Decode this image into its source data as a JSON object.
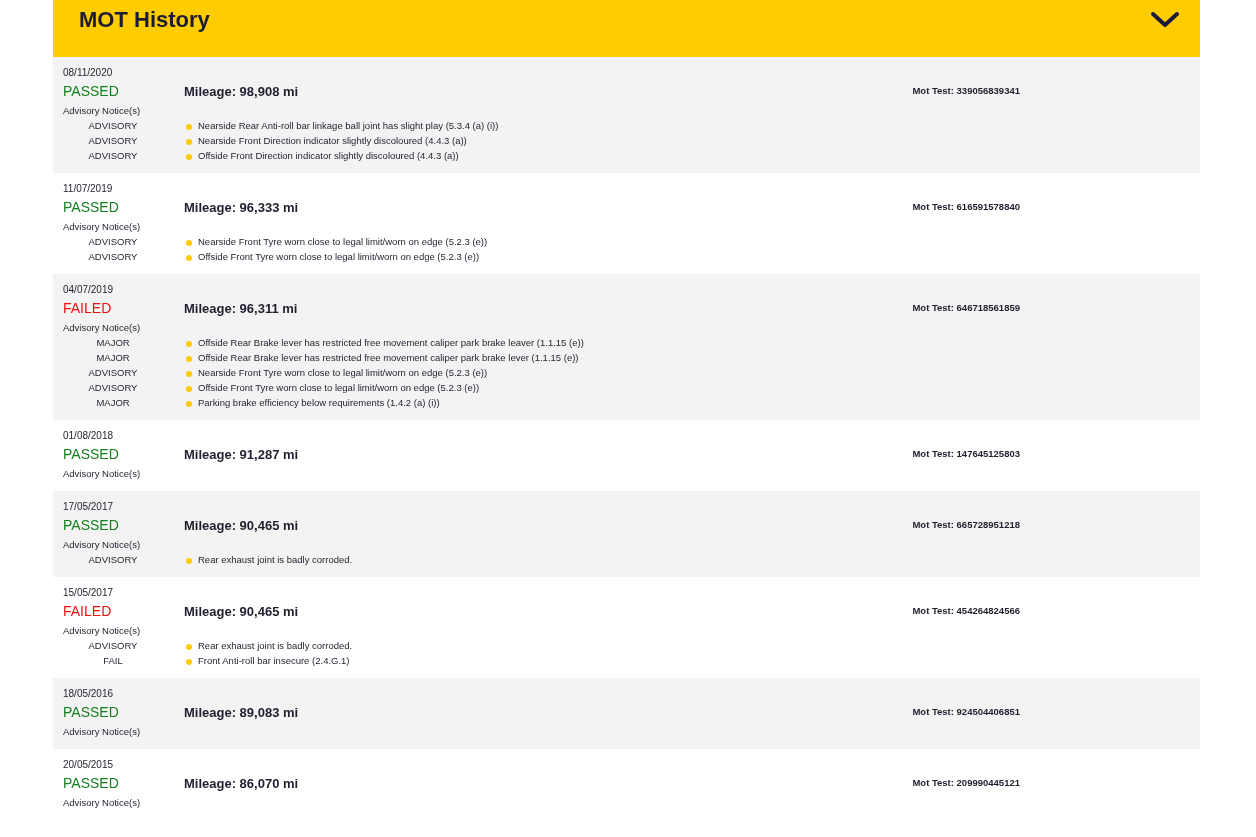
{
  "panel": {
    "title": "MOT History",
    "expanded": true
  },
  "tests": [
    {
      "date": "08/11/2020",
      "result": "PASSED",
      "kind": "passed",
      "mileage": "Mileage: 98,908 mi",
      "mot_test": "Mot Test: 339056839341",
      "notices_label": "Advisory Notice(s)",
      "items": [
        {
          "type": "ADVISORY",
          "text": "Nearside Rear Anti-roll bar linkage ball joint has slight play (5.3.4 (a) (i))"
        },
        {
          "type": "ADVISORY",
          "text": "Nearside Front Direction indicator slightly discoloured (4.4.3 (a))"
        },
        {
          "type": "ADVISORY",
          "text": "Offside Front Direction indicator slightly discoloured (4.4.3 (a))"
        }
      ]
    },
    {
      "date": "11/07/2019",
      "result": "PASSED",
      "kind": "passed",
      "mileage": "Mileage: 96,333 mi",
      "mot_test": "Mot Test: 616591578840",
      "notices_label": "Advisory Notice(s)",
      "items": [
        {
          "type": "ADVISORY",
          "text": "Nearside Front Tyre worn close to legal limit/worn on edge (5.2.3 (e))"
        },
        {
          "type": "ADVISORY",
          "text": "Offside Front Tyre worn close to legal limit/worn on edge (5.2.3 (e))"
        }
      ]
    },
    {
      "date": "04/07/2019",
      "result": "FAILED",
      "kind": "failed",
      "mileage": "Mileage: 96,311 mi",
      "mot_test": "Mot Test: 646718561859",
      "notices_label": "Advisory Notice(s)",
      "items": [
        {
          "type": "MAJOR",
          "text": "Offside Rear Brake lever has restricted free movement caliper park brake leaver (1.1.15 (e))"
        },
        {
          "type": "MAJOR",
          "text": "Offside Rear Brake lever has restricted free movement caliper park brake lever (1.1.15 (e))"
        },
        {
          "type": "ADVISORY",
          "text": "Nearside Front Tyre worn close to legal limit/worn on edge (5.2.3 (e))"
        },
        {
          "type": "ADVISORY",
          "text": "Offside Front Tyre worn close to legal limit/worn on edge (5.2.3 (e))"
        },
        {
          "type": "MAJOR",
          "text": "Parking brake efficiency below requirements (1.4.2 (a) (i))"
        }
      ]
    },
    {
      "date": "01/08/2018",
      "result": "PASSED",
      "kind": "passed",
      "mileage": "Mileage: 91,287 mi",
      "mot_test": "Mot Test: 147645125803",
      "notices_label": "Advisory Notice(s)"
    },
    {
      "date": "17/05/2017",
      "result": "PASSED",
      "kind": "passed",
      "mileage": "Mileage: 90,465 mi",
      "mot_test": "Mot Test: 665728951218",
      "notices_label": "Advisory Notice(s)",
      "items": [
        {
          "type": "ADVISORY",
          "text": "Rear exhaust joint is badly corroded."
        }
      ]
    },
    {
      "date": "15/05/2017",
      "result": "FAILED",
      "kind": "failed",
      "mileage": "Mileage: 90,465 mi",
      "mot_test": "Mot Test: 454264824566",
      "notices_label": "Advisory Notice(s)",
      "items": [
        {
          "type": "ADVISORY",
          "text": "Rear exhaust joint is badly corroded."
        },
        {
          "type": "FAIL",
          "text": "Front Anti-roll bar insecure (2.4.G.1)"
        }
      ]
    },
    {
      "date": "18/05/2016",
      "result": "PASSED",
      "kind": "passed",
      "mileage": "Mileage: 89,083 mi",
      "mot_test": "Mot Test: 924504406851",
      "notices_label": "Advisory Notice(s)"
    },
    {
      "date": "20/05/2015",
      "result": "PASSED",
      "kind": "passed",
      "mileage": "Mileage: 86,070 mi",
      "mot_test": "Mot Test: 209990445121",
      "notices_label": "Advisory Notice(s)"
    }
  ]
}
